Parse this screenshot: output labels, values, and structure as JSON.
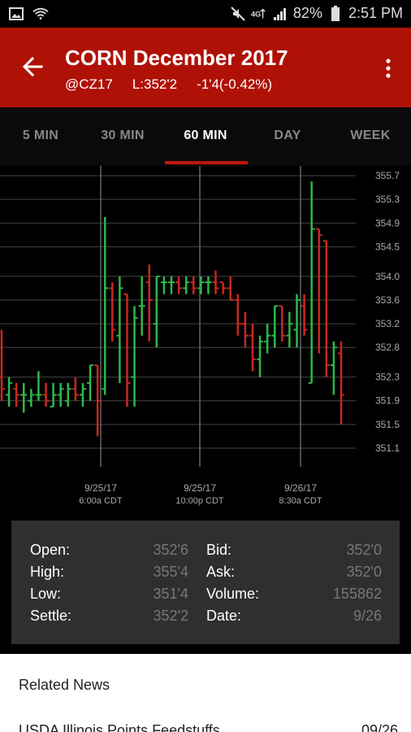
{
  "status_bar": {
    "battery": "82%",
    "time": "2:51 PM"
  },
  "header": {
    "title": "CORN December 2017",
    "symbol": "@CZ17",
    "last": "L:352'2",
    "change": "-1'4(-0.42%)"
  },
  "tabs": [
    {
      "label": "5 MIN"
    },
    {
      "label": "30 MIN"
    },
    {
      "label": "60 MIN",
      "active": true
    },
    {
      "label": "DAY"
    },
    {
      "label": "WEEK"
    }
  ],
  "chart_data": {
    "type": "ohlc",
    "y_ticks": [
      "355.7",
      "355.3",
      "354.9",
      "354.5",
      "354.0",
      "353.6",
      "353.2",
      "352.8",
      "352.3",
      "351.9",
      "351.5",
      "351.1"
    ],
    "x_labels": [
      {
        "date": "9/25/17",
        "time": "6:00a CDT"
      },
      {
        "date": "9/25/17",
        "time": "10:00p CDT"
      },
      {
        "date": "9/26/17",
        "time": "8:30a CDT"
      }
    ],
    "colors": {
      "up": "#2db84a",
      "down": "#c8281e",
      "grid": "#444444",
      "vline": "#666666",
      "axis_text": "#aaaaaa"
    },
    "bars": [
      {
        "open": 352.3,
        "high": 353.1,
        "low": 351.9,
        "close": 352.1
      },
      {
        "open": 352.0,
        "high": 352.3,
        "low": 351.8,
        "close": 352.2
      },
      {
        "open": 352.1,
        "high": 352.2,
        "low": 351.8,
        "close": 352.0
      },
      {
        "open": 352.0,
        "high": 352.2,
        "low": 351.7,
        "close": 352.0
      },
      {
        "open": 351.9,
        "high": 352.1,
        "low": 351.8,
        "close": 352.0
      },
      {
        "open": 352.0,
        "high": 352.4,
        "low": 351.9,
        "close": 352.0
      },
      {
        "open": 352.0,
        "high": 352.2,
        "low": 351.8,
        "close": 351.9
      },
      {
        "open": 351.8,
        "high": 352.2,
        "low": 351.8,
        "close": 352.0
      },
      {
        "open": 352.0,
        "high": 352.2,
        "low": 351.8,
        "close": 352.1
      },
      {
        "open": 351.9,
        "high": 352.2,
        "low": 351.8,
        "close": 352.1
      },
      {
        "open": 352.1,
        "high": 352.3,
        "low": 351.9,
        "close": 352.0
      },
      {
        "open": 352.0,
        "high": 352.2,
        "low": 351.8,
        "close": 352.1
      },
      {
        "open": 352.2,
        "high": 352.5,
        "low": 351.9,
        "close": 352.5
      },
      {
        "open": 352.5,
        "high": 352.5,
        "low": 351.3,
        "close": 351.9
      },
      {
        "open": 352.1,
        "high": 355.0,
        "low": 352.0,
        "close": 353.8
      },
      {
        "open": 353.8,
        "high": 353.9,
        "low": 352.9,
        "close": 353.1
      },
      {
        "open": 353.0,
        "high": 354.0,
        "low": 352.2,
        "close": 353.8
      },
      {
        "open": 353.7,
        "high": 353.7,
        "low": 351.8,
        "close": 352.2
      },
      {
        "open": 352.3,
        "high": 353.5,
        "low": 351.8,
        "close": 353.3
      },
      {
        "open": 353.5,
        "high": 354.0,
        "low": 353.0,
        "close": 353.5
      },
      {
        "open": 353.9,
        "high": 354.2,
        "low": 352.9,
        "close": 353.6
      },
      {
        "open": 353.2,
        "high": 354.0,
        "low": 352.8,
        "close": 354.0
      },
      {
        "open": 353.9,
        "high": 354.0,
        "low": 353.7,
        "close": 353.9
      },
      {
        "open": 353.9,
        "high": 354.0,
        "low": 353.7,
        "close": 353.9
      },
      {
        "open": 353.9,
        "high": 354.0,
        "low": 353.7,
        "close": 353.8
      },
      {
        "open": 353.8,
        "high": 354.0,
        "low": 353.7,
        "close": 353.9
      },
      {
        "open": 353.9,
        "high": 354.0,
        "low": 353.7,
        "close": 353.8
      },
      {
        "open": 353.8,
        "high": 354.0,
        "low": 353.7,
        "close": 353.9
      },
      {
        "open": 353.9,
        "high": 354.0,
        "low": 353.7,
        "close": 353.9
      },
      {
        "open": 353.9,
        "high": 354.1,
        "low": 353.7,
        "close": 353.8
      },
      {
        "open": 353.9,
        "high": 353.9,
        "low": 353.7,
        "close": 353.8
      },
      {
        "open": 353.8,
        "high": 354.0,
        "low": 353.6,
        "close": 353.6
      },
      {
        "open": 353.6,
        "high": 353.7,
        "low": 353.0,
        "close": 353.2
      },
      {
        "open": 353.2,
        "high": 353.4,
        "low": 352.8,
        "close": 353.0
      },
      {
        "open": 353.0,
        "high": 353.2,
        "low": 352.4,
        "close": 352.6
      },
      {
        "open": 352.6,
        "high": 353.0,
        "low": 352.3,
        "close": 352.9
      },
      {
        "open": 352.9,
        "high": 353.2,
        "low": 352.7,
        "close": 353.0
      },
      {
        "open": 353.0,
        "high": 353.5,
        "low": 352.8,
        "close": 353.5
      },
      {
        "open": 353.5,
        "high": 353.5,
        "low": 352.9,
        "close": 353.0
      },
      {
        "open": 353.0,
        "high": 353.4,
        "low": 352.8,
        "close": 353.2
      },
      {
        "open": 353.1,
        "high": 353.7,
        "low": 352.8,
        "close": 353.6
      },
      {
        "open": 353.5,
        "high": 353.7,
        "low": 353.0,
        "close": 353.1
      },
      {
        "open": 352.2,
        "high": 355.6,
        "low": 352.2,
        "close": 354.8
      },
      {
        "open": 354.8,
        "high": 354.8,
        "low": 352.7,
        "close": 354.7
      },
      {
        "open": 354.6,
        "high": 354.6,
        "low": 352.3,
        "close": 352.5
      },
      {
        "open": 352.5,
        "high": 352.9,
        "low": 352.0,
        "close": 352.8
      },
      {
        "open": 352.7,
        "high": 352.9,
        "low": 351.5,
        "close": 352.0
      }
    ]
  },
  "stats": {
    "open_label": "Open:",
    "open_value": "352'6",
    "high_label": "High:",
    "high_value": "355'4",
    "low_label": "Low:",
    "low_value": "351'4",
    "settle_label": "Settle:",
    "settle_value": "352'2",
    "bid_label": "Bid:",
    "bid_value": "352'0",
    "ask_label": "Ask:",
    "ask_value": "352'0",
    "volume_label": "Volume:",
    "volume_value": "155862",
    "date_label": "Date:",
    "date_value": "9/26"
  },
  "related": {
    "title": "Related News",
    "first_item_text": "USDA Illinois Points Feedstuffs",
    "first_item_date": "09/26"
  }
}
